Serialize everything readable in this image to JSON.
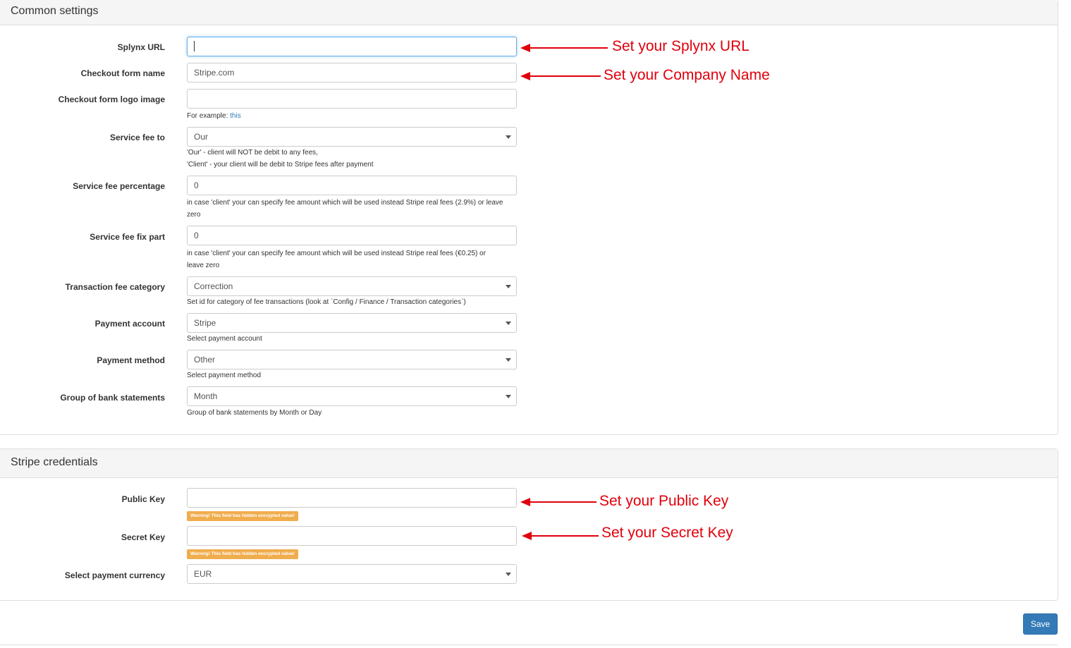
{
  "common": {
    "title": "Common settings",
    "fields": {
      "splynx_url": {
        "label": "Splynx URL",
        "value": ""
      },
      "checkout_name": {
        "label": "Checkout form name",
        "value": "Stripe.com"
      },
      "checkout_logo": {
        "label": "Checkout form logo image",
        "value": "",
        "help_prefix": "For example: ",
        "help_link": "this"
      },
      "service_fee_to": {
        "label": "Service fee to",
        "value": "Our",
        "help1": "'Our' - client will NOT be debit to any fees,",
        "help2": "'Client' - your client will be debit to Stripe fees after payment"
      },
      "service_fee_percentage": {
        "label": "Service fee percentage",
        "value": "0",
        "help1": "in case 'client' your can specify fee amount which will be used instead Stripe real fees (2.9%) or leave",
        "help2": "zero"
      },
      "service_fee_fix": {
        "label": "Service fee fix part",
        "value": "0",
        "help1": "in case 'client' your can specify fee amount which will be used instead Stripe real fees (€0.25) or",
        "help2": "leave zero"
      },
      "transaction_fee_category": {
        "label": "Transaction fee category",
        "value": "Correction",
        "help": "Set id for category of fee transactions (look at `Config / Finance / Transaction categories`)"
      },
      "payment_account": {
        "label": "Payment account",
        "value": "Stripe",
        "help": "Select payment account"
      },
      "payment_method": {
        "label": "Payment method",
        "value": "Other",
        "help": "Select payment method"
      },
      "group_statements": {
        "label": "Group of bank statements",
        "value": "Month",
        "help": "Group of bank statements by Month or Day"
      }
    }
  },
  "credentials": {
    "title": "Stripe credentials",
    "fields": {
      "public_key": {
        "label": "Public Key",
        "value": "",
        "warning": "Warning! This field has hidden encrypted value!"
      },
      "secret_key": {
        "label": "Secret Key",
        "value": "",
        "warning": "Warning! This field has hidden encrypted value!"
      },
      "currency": {
        "label": "Select payment currency",
        "value": "EUR"
      }
    }
  },
  "annotations": {
    "url": "Set your Splynx URL",
    "company": "Set your Company Name",
    "public": "Set your Public Key",
    "secret": "Set your Secret Key"
  },
  "save_label": "Save",
  "colors": {
    "annotation": "#e0000b",
    "primary": "#337ab7",
    "warning": "#f0ad4e"
  }
}
